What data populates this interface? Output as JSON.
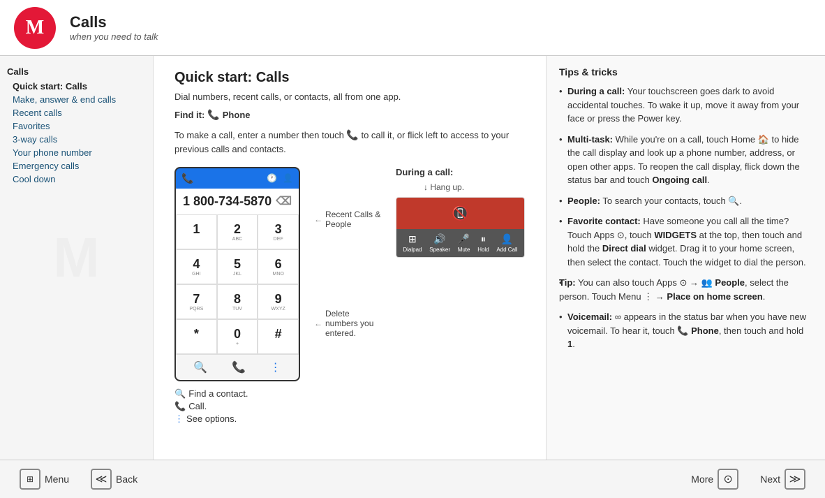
{
  "header": {
    "title": "Calls",
    "subtitle": "when you need to talk",
    "logo_letter": "M"
  },
  "sidebar": {
    "section_title": "Calls",
    "items": [
      {
        "label": "Quick start: Calls",
        "bold": true
      },
      {
        "label": "Make, answer & end calls",
        "bold": false
      },
      {
        "label": "Recent calls",
        "bold": false
      },
      {
        "label": "Favorites",
        "bold": false
      },
      {
        "label": "3-way calls",
        "bold": false
      },
      {
        "label": "Your phone number",
        "bold": false
      },
      {
        "label": "Emergency calls",
        "bold": false
      },
      {
        "label": "Cool down",
        "bold": false
      }
    ]
  },
  "main": {
    "section_title": "Quick start: Calls",
    "description": "Dial numbers, recent calls, or contacts, all from one app.",
    "find_it_label": "Find it:",
    "find_it_app": "Phone",
    "instruction": "To make a call, enter a number then touch  to call it, or flick left to access to your previous calls and contacts.",
    "phone_number": "1 800-734-5870",
    "keypad": [
      {
        "num": "1",
        "letters": ""
      },
      {
        "num": "2",
        "letters": "ABC"
      },
      {
        "num": "3",
        "letters": "DEF"
      },
      {
        "num": "4",
        "letters": "GHI"
      },
      {
        "num": "5",
        "letters": "JKL"
      },
      {
        "num": "6",
        "letters": "MNO"
      },
      {
        "num": "7",
        "letters": "PQRS"
      },
      {
        "num": "8",
        "letters": "TUV"
      },
      {
        "num": "9",
        "letters": "WXYZ"
      },
      {
        "num": "*",
        "letters": ""
      },
      {
        "num": "0",
        "letters": "+"
      },
      {
        "num": "#",
        "letters": ""
      }
    ],
    "annotation_recent": "Recent Calls & People",
    "annotation_delete": "Delete numbers you entered.",
    "during_call_label": "During a call:",
    "hang_up_label": "Hang up.",
    "annotations_bottom": [
      {
        "icon": "🔍",
        "text": "Find a contact."
      },
      {
        "icon": "📞",
        "text": "Call."
      },
      {
        "icon": "⋮",
        "text": "See options."
      }
    ],
    "call_options": [
      {
        "icon": "⊞",
        "label": "Dialpad"
      },
      {
        "icon": "🔊",
        "label": "Speaker"
      },
      {
        "icon": "🎤",
        "label": "Mute"
      },
      {
        "icon": "⏸",
        "label": "Hold"
      },
      {
        "icon": "👤",
        "label": "Add Call"
      }
    ]
  },
  "tips": {
    "title": "Tips & tricks",
    "items": [
      {
        "term": "During a call:",
        "text": " Your touchscreen goes dark to avoid accidental touches. To wake it up, move it away from your face or press the Power key."
      },
      {
        "term": "Multi-task:",
        "text": " While you're on a call, touch Home  to hide the call display and look up a phone number, address, or open other apps. To reopen the call display, flick down the status bar and touch ",
        "bold_end": "Ongoing call",
        "text_end": "."
      },
      {
        "term": "People:",
        "text": " To search your contacts, touch 🔍."
      },
      {
        "term": "Favorite contact:",
        "text": " Have someone you call all the time? Touch Apps ⊙, touch ",
        "bold_mid": "WIDGETS",
        "text_mid": " at the top, then touch and hold the ",
        "bold_mid2": "Direct dial",
        "text_mid2": " widget. Drag it to your home screen, then select the contact. Touch the widget to dial the person."
      },
      {
        "tip_label": "Tip:",
        "text": " You can also touch Apps ⊙ → 👥 ",
        "bold_mid": "People",
        "text_mid": ", select the person. Touch Menu ",
        "bold_end": "→ Place on home screen",
        "text_end": "."
      },
      {
        "term": "Voicemail:",
        "text": " ∞ appears in the status bar when you have new voicemail. To hear it, touch 📞 ",
        "bold_mid": "Phone",
        "text_mid": ", then touch and hold ",
        "bold_end": "1",
        "text_end": "."
      }
    ]
  },
  "footer": {
    "menu_label": "Menu",
    "back_label": "Back",
    "more_label": "More",
    "next_label": "Next"
  }
}
